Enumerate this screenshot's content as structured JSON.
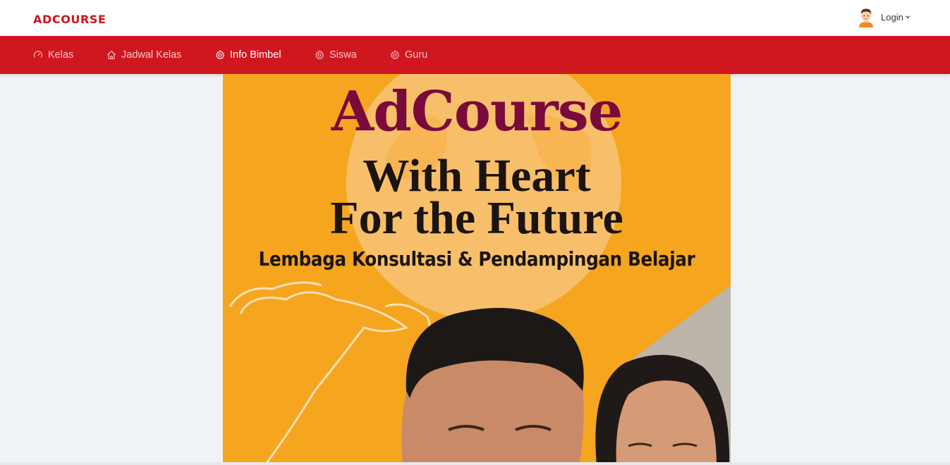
{
  "header": {
    "brand": "ADCOURSE",
    "user": {
      "login_label": "Login",
      "avatar_icon": "user-avatar-icon",
      "caret_icon": "chevron-down-icon"
    }
  },
  "nav": {
    "items": [
      {
        "label": "Kelas",
        "icon": "gauge-icon",
        "active": false
      },
      {
        "label": "Jadwal Kelas",
        "icon": "home-icon",
        "active": false
      },
      {
        "label": "Info Bimbel",
        "icon": "gear-icon",
        "active": true
      },
      {
        "label": "Siswa",
        "icon": "gear-icon",
        "active": false
      },
      {
        "label": "Guru",
        "icon": "gear-icon",
        "active": false
      }
    ]
  },
  "banner": {
    "title": "AdCourse",
    "line1": "With Heart",
    "line2": "For the Future",
    "subtitle": "Lembaga Konsultasi & Pendampingan Belajar"
  },
  "colors": {
    "brand_red": "#cc141c",
    "navbar_red": "#d0161e",
    "banner_orange": "#f6a51f",
    "title_maroon": "#7a0a3c",
    "page_bg": "#f0f3f6"
  }
}
